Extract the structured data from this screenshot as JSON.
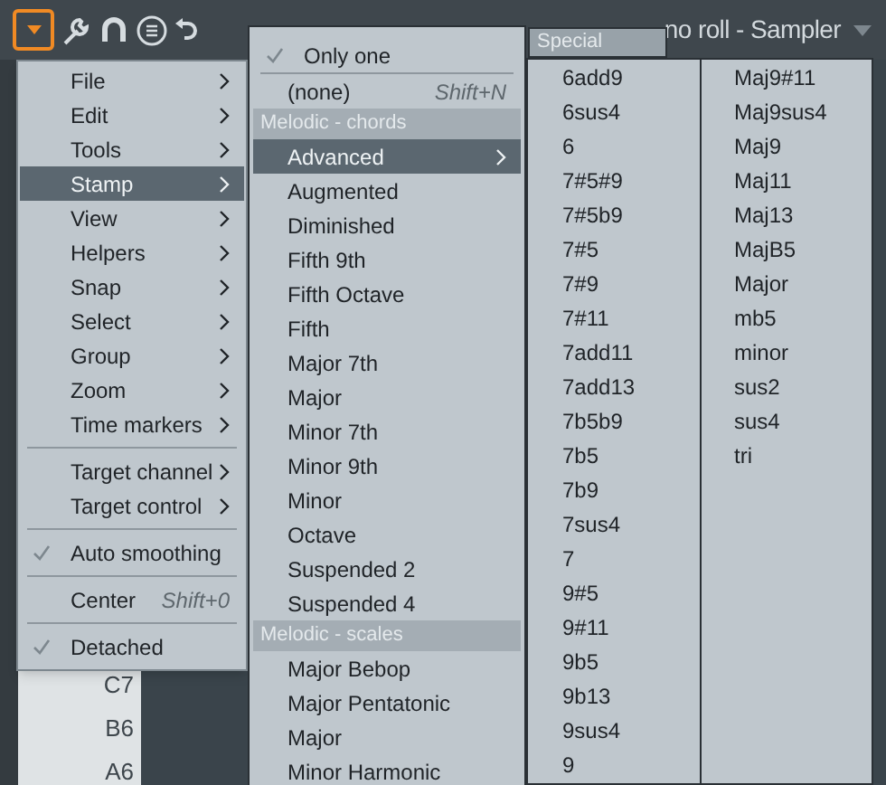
{
  "toolbar": {
    "title": "no roll - Sampler"
  },
  "piano_keys": [
    "C7",
    "B6",
    "A6"
  ],
  "main_menu": [
    {
      "kind": "submenu",
      "label": "File",
      "selected": false
    },
    {
      "kind": "submenu",
      "label": "Edit",
      "selected": false
    },
    {
      "kind": "submenu",
      "label": "Tools",
      "selected": false
    },
    {
      "kind": "submenu",
      "label": "Stamp",
      "selected": true
    },
    {
      "kind": "submenu",
      "label": "View",
      "selected": false
    },
    {
      "kind": "submenu",
      "label": "Helpers",
      "selected": false
    },
    {
      "kind": "submenu",
      "label": "Snap",
      "selected": false
    },
    {
      "kind": "submenu",
      "label": "Select",
      "selected": false
    },
    {
      "kind": "submenu",
      "label": "Group",
      "selected": false
    },
    {
      "kind": "submenu",
      "label": "Zoom",
      "selected": false
    },
    {
      "kind": "submenu",
      "label": "Time markers",
      "selected": false
    },
    {
      "kind": "separator"
    },
    {
      "kind": "submenu",
      "label": "Target channel",
      "selected": false
    },
    {
      "kind": "submenu",
      "label": "Target control",
      "selected": false
    },
    {
      "kind": "separator"
    },
    {
      "kind": "check",
      "label": "Auto smoothing",
      "checked": true
    },
    {
      "kind": "separator"
    },
    {
      "kind": "action",
      "label": "Center",
      "shortcut": "Shift+0"
    },
    {
      "kind": "separator"
    },
    {
      "kind": "check",
      "label": "Detached",
      "checked": true
    }
  ],
  "stamp_menu": [
    {
      "kind": "check",
      "label": "Only one",
      "checked": true
    },
    {
      "kind": "separator"
    },
    {
      "kind": "action",
      "label": "(none)",
      "shortcut": "Shift+N"
    },
    {
      "kind": "section",
      "label": "Melodic - chords"
    },
    {
      "kind": "submenu",
      "label": "Advanced",
      "selected": true
    },
    {
      "kind": "item",
      "label": "Augmented"
    },
    {
      "kind": "item",
      "label": "Diminished"
    },
    {
      "kind": "item",
      "label": "Fifth 9th"
    },
    {
      "kind": "item",
      "label": "Fifth Octave"
    },
    {
      "kind": "item",
      "label": "Fifth"
    },
    {
      "kind": "item",
      "label": "Major 7th"
    },
    {
      "kind": "item",
      "label": "Major"
    },
    {
      "kind": "item",
      "label": "Minor 7th"
    },
    {
      "kind": "item",
      "label": "Minor 9th"
    },
    {
      "kind": "item",
      "label": "Minor"
    },
    {
      "kind": "item",
      "label": "Octave"
    },
    {
      "kind": "item",
      "label": "Suspended 2"
    },
    {
      "kind": "item",
      "label": "Suspended 4"
    },
    {
      "kind": "section",
      "label": "Melodic - scales"
    },
    {
      "kind": "item",
      "label": "Major Bebop"
    },
    {
      "kind": "item",
      "label": "Major Pentatonic"
    },
    {
      "kind": "item",
      "label": "Major"
    },
    {
      "kind": "item",
      "label": "Minor Harmonic"
    }
  ],
  "special_menu": {
    "header": "Special",
    "columns": [
      [
        "6add9",
        "6sus4",
        "6",
        "7#5#9",
        "7#5b9",
        "7#5",
        "7#9",
        "7#11",
        "7add11",
        "7add13",
        "7b5b9",
        "7b5",
        "7b9",
        "7sus4",
        "7",
        "9#5",
        "9#11",
        "9b5",
        "9b13",
        "9sus4",
        "9"
      ],
      [
        "Maj9#11",
        "Maj9sus4",
        "Maj9",
        "Maj11",
        "Maj13",
        "MajB5",
        "Major",
        "mb5",
        "minor",
        "sus2",
        "sus4",
        "tri"
      ]
    ]
  }
}
